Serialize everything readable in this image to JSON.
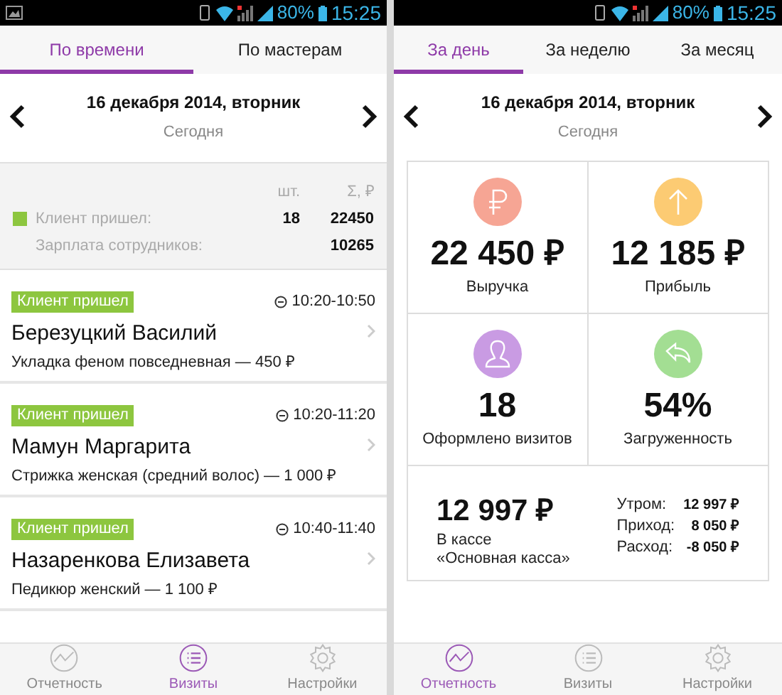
{
  "visits_screen": {
    "status_bar": {
      "battery": "80%",
      "time": "15:25"
    },
    "tabs": [
      {
        "label": "По времени",
        "selected": true
      },
      {
        "label": "По мастерам",
        "selected": false
      }
    ],
    "date": "16 декабря 2014, вторник",
    "day_label": "Сегодня",
    "summary": {
      "columns": [
        "шт.",
        "Σ, ₽"
      ],
      "rows": [
        {
          "label": "Клиент пришел:",
          "color": "#8dc63f",
          "count": "18",
          "sum": "22450"
        },
        {
          "label": "Зарплата сотрудников:",
          "sum": "10265"
        }
      ]
    },
    "visits": [
      {
        "status": "Клиент пришел",
        "time": "10:20-10:50",
        "client": "Березуцкий Василий",
        "service": "Укладка феном повседневная — 450 ₽"
      },
      {
        "status": "Клиент пришел",
        "time": "10:20-11:20",
        "client": "Мамун Маргарита",
        "service": "Стрижка женская (средний волос) — 1 000 ₽"
      },
      {
        "status": "Клиент пришел",
        "time": "10:40-11:40",
        "client": "Назаренкова Елизавета",
        "service": "Педикюр женский — 1 100 ₽"
      }
    ],
    "bottom_nav": [
      {
        "kind": "reports",
        "label": "Отчетность",
        "selected": false
      },
      {
        "kind": "visits",
        "label": "Визиты",
        "selected": true
      },
      {
        "kind": "settings",
        "label": "Настройки",
        "selected": false
      }
    ]
  },
  "reports_screen": {
    "status_bar": {
      "battery": "80%",
      "time": "15:25"
    },
    "tabs": [
      {
        "label": "За день",
        "selected": true
      },
      {
        "label": "За неделю",
        "selected": false
      },
      {
        "label": "За месяц",
        "selected": false
      }
    ],
    "date": "16 декабря 2014, вторник",
    "day_label": "Сегодня",
    "stats": [
      {
        "kind": "ruble",
        "value": "22 450 ₽",
        "label": "Выручка"
      },
      {
        "kind": "arrow",
        "value": "12 185 ₽",
        "label": "Прибыль"
      },
      {
        "kind": "person",
        "value": "18",
        "label": "Оформлено визитов"
      },
      {
        "kind": "reply",
        "value": "54%",
        "label": "Загруженность"
      }
    ],
    "cash": {
      "value": "12 997 ₽",
      "label": "В кассе",
      "register": "«Основная касса»",
      "lines": [
        {
          "label": "Утром:",
          "value": "12 997 ₽"
        },
        {
          "label": "Приход:",
          "value": "8 050 ₽"
        },
        {
          "label": "Расход:",
          "value": "-8 050 ₽"
        }
      ]
    },
    "bottom_nav": [
      {
        "kind": "reports",
        "label": "Отчетность",
        "selected": true
      },
      {
        "kind": "visits",
        "label": "Визиты",
        "selected": false
      },
      {
        "kind": "settings",
        "label": "Настройки",
        "selected": false
      }
    ]
  }
}
